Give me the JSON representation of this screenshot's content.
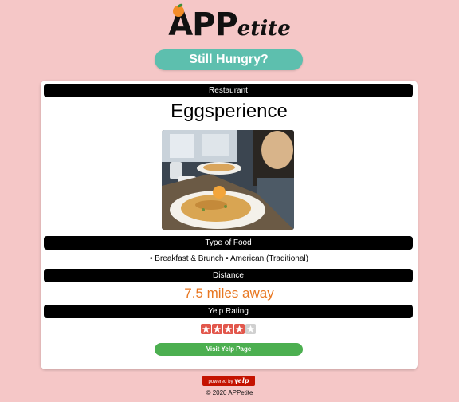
{
  "header": {
    "logo_main": "APP",
    "logo_suffix": "etite",
    "logo_icon": "orange-icon"
  },
  "actions": {
    "still_hungry_label": "Still Hungry?",
    "visit_yelp_label": "Visit Yelp Page"
  },
  "restaurant": {
    "section_label": "Restaurant",
    "name": "Eggsperience",
    "food_type_label": "Type of Food",
    "food_types": "• Breakfast & Brunch • American (Traditional)",
    "distance_label": "Distance",
    "distance": "7.5 miles away",
    "rating_label": "Yelp Rating",
    "rating": 4,
    "rating_max": 5
  },
  "footer": {
    "powered_by": "powered by",
    "powered_brand": "yelp",
    "copyright": "© 2020 APPetite"
  },
  "colors": {
    "background": "#f5c7c7",
    "accent_teal": "#5dbfae",
    "distance_orange": "#e87722",
    "star_red": "#e2574c",
    "yelp_green": "#4caf50",
    "yelp_red": "#c41200"
  }
}
